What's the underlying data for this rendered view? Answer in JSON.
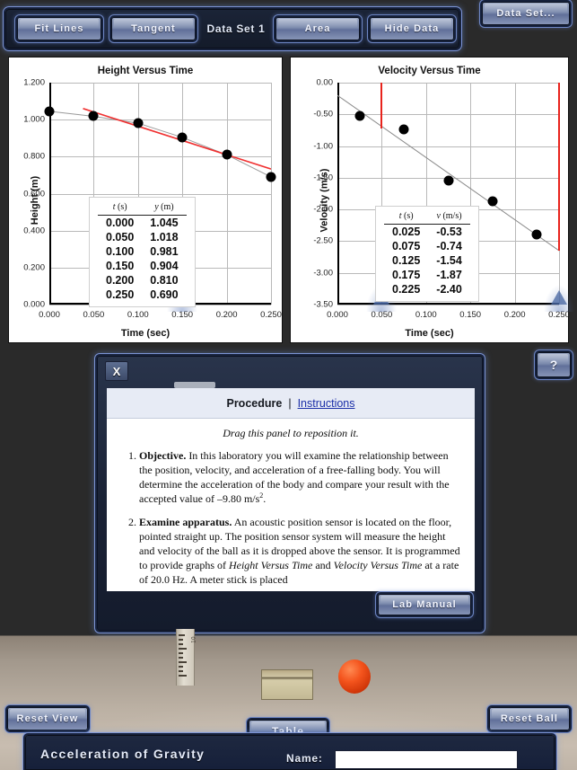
{
  "toolbar": {
    "fit_lines": "Fit Lines",
    "tangent": "Tangent",
    "data_set_label": "Data Set 1",
    "area": "Area",
    "hide_data": "Hide Data",
    "data_set_menu": "Data Set..."
  },
  "help_button": "?",
  "chart_data": [
    {
      "type": "scatter",
      "title": "Height Versus Time",
      "xlabel": "Time (sec)",
      "ylabel": "Height (m)",
      "xlim": [
        0.0,
        0.25
      ],
      "ylim": [
        0.0,
        1.2
      ],
      "xticks": [
        "0.000",
        "0.050",
        "0.100",
        "0.150",
        "0.200",
        "0.250"
      ],
      "xtick_values": [
        0.0,
        0.05,
        0.1,
        0.15,
        0.2,
        0.25
      ],
      "yticks": [
        "0.000",
        "0.200",
        "0.400",
        "0.600",
        "0.800",
        "1.000",
        "1.200"
      ],
      "ytick_values": [
        0.0,
        0.2,
        0.4,
        0.6,
        0.8,
        1.0,
        1.2
      ],
      "grid": true,
      "x": [
        0.0,
        0.05,
        0.1,
        0.15,
        0.2,
        0.25
      ],
      "y": [
        1.045,
        1.018,
        0.981,
        0.904,
        0.81,
        0.69
      ],
      "fit_line": {
        "color": "#f03030",
        "x0": 0.038,
        "y0": 1.06,
        "x1": 0.25,
        "y1": 0.733
      },
      "connector_color": "#9a9a9a",
      "marker_positions": [
        0.15
      ],
      "table": {
        "headers": [
          "t (s)",
          "y (m)"
        ],
        "header_italic": [
          "t",
          "y"
        ],
        "rows": [
          [
            "0.000",
            "1.045"
          ],
          [
            "0.050",
            "1.018"
          ],
          [
            "0.100",
            "0.981"
          ],
          [
            "0.150",
            "0.904"
          ],
          [
            "0.200",
            "0.810"
          ],
          [
            "0.250",
            "0.690"
          ]
        ]
      }
    },
    {
      "type": "scatter",
      "title": "Velocity Versus Time",
      "xlabel": "Time (sec)",
      "ylabel": "Velocity (m/s)",
      "xlim": [
        0.0,
        0.25
      ],
      "ylim": [
        -3.5,
        0.0
      ],
      "xticks": [
        "0.000",
        "0.050",
        "0.100",
        "0.150",
        "0.200",
        "0.250"
      ],
      "xtick_values": [
        0.0,
        0.05,
        0.1,
        0.15,
        0.2,
        0.25
      ],
      "yticks": [
        "0.00",
        "-0.50",
        "-1.00",
        "-1.50",
        "-2.00",
        "-2.50",
        "-3.00",
        "-3.50"
      ],
      "ytick_values": [
        0.0,
        -0.5,
        -1.0,
        -1.5,
        -2.0,
        -2.5,
        -3.0,
        -3.5
      ],
      "grid": true,
      "x": [
        0.025,
        0.075,
        0.125,
        0.175,
        0.225
      ],
      "y": [
        -0.53,
        -0.74,
        -1.54,
        -1.87,
        -2.4
      ],
      "fit_line": {
        "color": "#8a8a8a",
        "x0": 0.0,
        "y0": -0.2,
        "x1": 0.25,
        "y1": -2.65
      },
      "red_verticals": [
        {
          "x": 0.05,
          "y_top": 0.0,
          "y_bottom": -0.72
        },
        {
          "x": 0.25,
          "y_top": 0.0,
          "y_bottom": -2.65
        }
      ],
      "marker_positions": [
        0.05,
        0.25
      ],
      "table": {
        "headers": [
          "t (s)",
          "v (m/s)"
        ],
        "header_italic": [
          "t",
          "v"
        ],
        "rows": [
          [
            "0.025",
            "-0.53"
          ],
          [
            "0.075",
            "-0.74"
          ],
          [
            "0.125",
            "-1.54"
          ],
          [
            "0.175",
            "-1.87"
          ],
          [
            "0.225",
            "-2.40"
          ]
        ]
      }
    }
  ],
  "procedure_panel": {
    "close_label": "X",
    "title": "Procedure",
    "separator": "|",
    "link": "Instructions",
    "drag_note": "Drag this panel to reposition it.",
    "steps": [
      {
        "heading": "Objective.",
        "body_before_sup": " In this laboratory you will examine the relationship between the position, velocity, and acceleration of a free-falling body. You will determine the acceleration of the body and compare your result with the accepted value of –9.80 m/s",
        "sup": "2",
        "body_after_sup": "."
      },
      {
        "heading": "Examine apparatus.",
        "body_1": " An acoustic position sensor is located on the floor, pointed straight up. The position sensor system will measure the height and velocity of the ball as it is dropped above the sensor. It is programmed to provide graphs of ",
        "italic_1": "Height Versus Time",
        "body_2": " and ",
        "italic_2": "Velocity Versus Time",
        "body_3": " at a rate of 20.0 Hz. A meter stick is placed"
      }
    ],
    "lab_manual": "Lab Manual"
  },
  "scene": {
    "reset_view": "Reset View",
    "reset_ball": "Reset Ball",
    "table_button": "Table",
    "meter_stick_number": "10"
  },
  "bottom_bar": {
    "title": "Acceleration of Gravity",
    "name_label": "Name:",
    "name_value": "",
    "name_placeholder": ""
  },
  "colors": {
    "accent_blue": "#7d95d6",
    "panel_dark": "#1a2235",
    "fit_red": "#f03030",
    "ball_orange": "#f4541d"
  }
}
